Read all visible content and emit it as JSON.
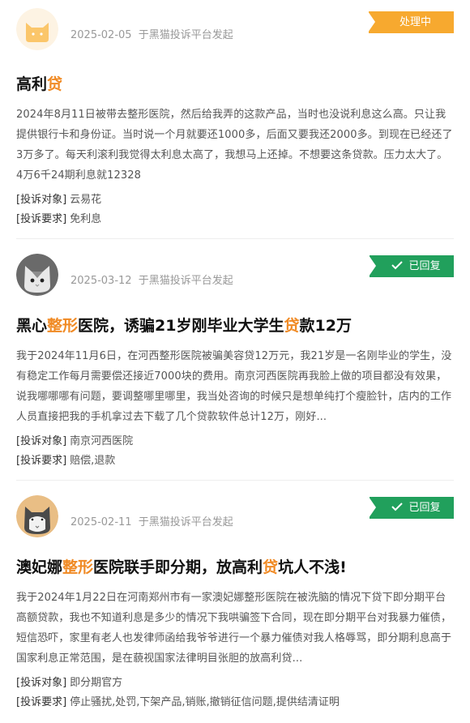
{
  "complaints": [
    {
      "avatar": "cat-avatar-yellow",
      "date": "2025-02-05",
      "platform_text": "于黑猫投诉平台发起",
      "status": "处理中",
      "status_type": "pending",
      "title_parts": [
        {
          "text": "高利",
          "hl": false
        },
        {
          "text": "贷",
          "hl": true
        }
      ],
      "description": "2024年8月11日被带去整形医院，然后给我弄的这款产品，当时也没说利息这么高。只让我提供银行卡和身份证。当时说一个月就要还1000多，后面又要我还2000多。到现在已经还了3万多了。每天利滚利我觉得太利息太高了，我想马上还掉。不想要这条贷款。压力太大了。4万6千24期利息就12328",
      "target_label": "[投诉对象]",
      "target": "云易花",
      "demand_label": "[投诉要求]",
      "demand": "免利息"
    },
    {
      "avatar": "cat-avatar-gray",
      "date": "2025-03-12",
      "platform_text": "于黑猫投诉平台发起",
      "status": "已回复",
      "status_type": "replied",
      "title_parts": [
        {
          "text": "黑心",
          "hl": false
        },
        {
          "text": "整形",
          "hl": true
        },
        {
          "text": "医院，诱骗21岁刚毕业大学生",
          "hl": false
        },
        {
          "text": "贷",
          "hl": true
        },
        {
          "text": "款12万",
          "hl": false
        }
      ],
      "description": "我于2024年11月6日，在河西整形医院被骗美容贷12万元，我21岁是一名刚毕业的学生，没有稳定工作每月需要偿还接近7000块的费用。南京河西医院再我脸上做的项目都没有效果，说我哪哪哪有问题，要调整哪里哪里，我当处咨询的时候只是想单纯打个瘦脸针，店内的工作人员直接把我的手机拿过去下载了几个贷款软件总计12万，刚好...",
      "target_label": "[投诉对象]",
      "target": "南京河西医院",
      "demand_label": "[投诉要求]",
      "demand": "赔偿,退款"
    },
    {
      "avatar": "cat-avatar-tan",
      "date": "2025-02-11",
      "platform_text": "于黑猫投诉平台发起",
      "status": "已回复",
      "status_type": "replied",
      "title_parts": [
        {
          "text": "澳妃娜",
          "hl": false
        },
        {
          "text": "整形",
          "hl": true
        },
        {
          "text": "医院联手即分期，放高利",
          "hl": false
        },
        {
          "text": "贷",
          "hl": true
        },
        {
          "text": "坑人不浅!",
          "hl": false
        }
      ],
      "description": "我于2024年1月22日在河南郑州市有一家澳妃娜整形医院在被洗脑的情况下贷下即分期平台高额贷款，我也不知道利息是多少的情况下我哄骗签下合同，现在即分期平台对我暴力催债，短信恐吓，家里有老人也发律师函给我爷爷进行一个暴力催债对我人格辱骂，即分期利息高于国家利息正常范围，是在藐视国家法律明目张胆的放高利贷...",
      "target_label": "[投诉对象]",
      "target": "即分期官方",
      "demand_label": "[投诉要求]",
      "demand": "停止骚扰,处罚,下架产品,销账,撤销征信问题,提供结清证明"
    }
  ]
}
